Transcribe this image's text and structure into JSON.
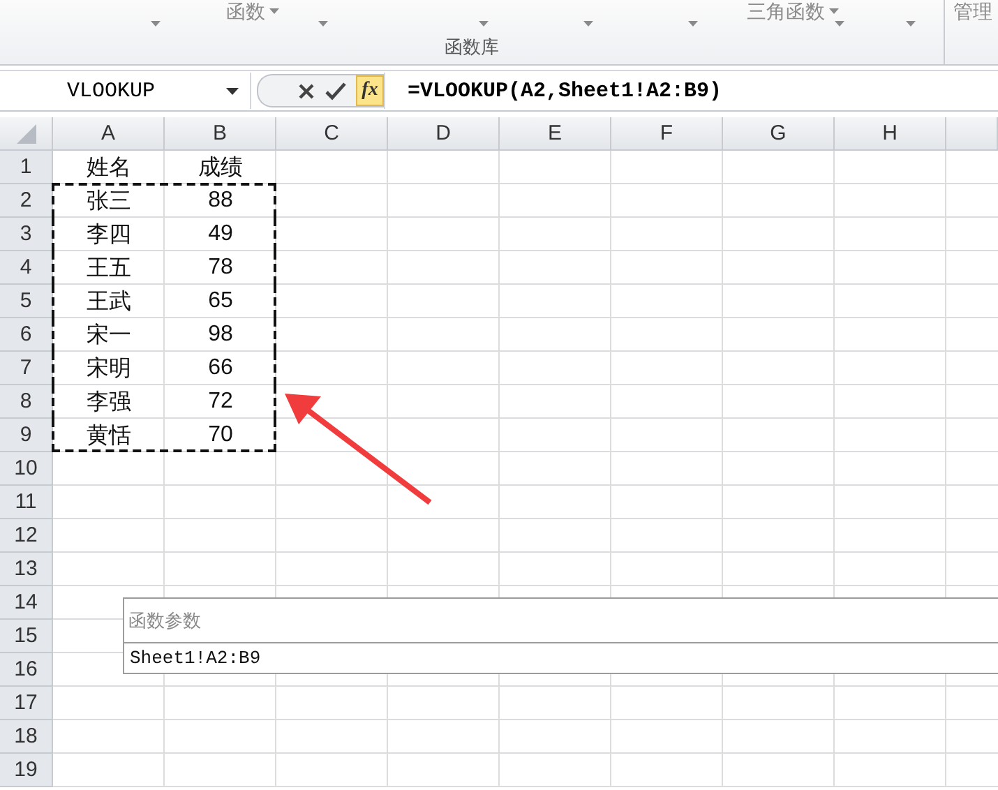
{
  "ribbon": {
    "groups": [
      {
        "kind": "dropdown",
        "label": "函数"
      },
      {
        "kind": "dropdown",
        "label": "三角函数"
      },
      {
        "kind": "plain",
        "label": "管理"
      }
    ],
    "group_title": "函数库"
  },
  "formula_bar": {
    "name_box": "VLOOKUP",
    "fx_button": "fx",
    "formula": "=VLOOKUP(A2,Sheet1!A2:B9)"
  },
  "sheet": {
    "columns": [
      "A",
      "B",
      "C",
      "D",
      "E",
      "F",
      "G",
      "H"
    ],
    "rows": [
      {
        "header": "1",
        "cells": [
          "姓名",
          "成绩"
        ],
        "marquee": false
      },
      {
        "header": "2",
        "cells": [
          "张三",
          "88"
        ],
        "marquee": true
      },
      {
        "header": "3",
        "cells": [
          "李四",
          "49"
        ],
        "marquee": true
      },
      {
        "header": "4",
        "cells": [
          "王五",
          "78"
        ],
        "marquee": true
      },
      {
        "header": "5",
        "cells": [
          "王武",
          "65"
        ],
        "marquee": true
      },
      {
        "header": "6",
        "cells": [
          "宋一",
          "98"
        ],
        "marquee": true
      },
      {
        "header": "7",
        "cells": [
          "宋明",
          "66"
        ],
        "marquee": true
      },
      {
        "header": "8",
        "cells": [
          "李强",
          "72"
        ],
        "marquee": true
      },
      {
        "header": "9",
        "cells": [
          "黄恬",
          "70"
        ],
        "marquee": true
      },
      {
        "header": "10",
        "cells": [],
        "marquee": false
      },
      {
        "header": "11",
        "cells": [],
        "marquee": false
      },
      {
        "header": "12",
        "cells": [],
        "marquee": false
      },
      {
        "header": "13",
        "cells": [],
        "marquee": false
      },
      {
        "header": "14",
        "cells": [],
        "marquee": false
      },
      {
        "header": "15",
        "cells": [],
        "marquee": false
      },
      {
        "header": "16",
        "cells": [],
        "marquee": false
      },
      {
        "header": "17",
        "cells": [],
        "marquee": false
      },
      {
        "header": "18",
        "cells": [],
        "marquee": false
      },
      {
        "header": "19",
        "cells": [],
        "marquee": false
      }
    ]
  },
  "dialog": {
    "title": "函数参数",
    "value": "Sheet1!A2:B9"
  }
}
